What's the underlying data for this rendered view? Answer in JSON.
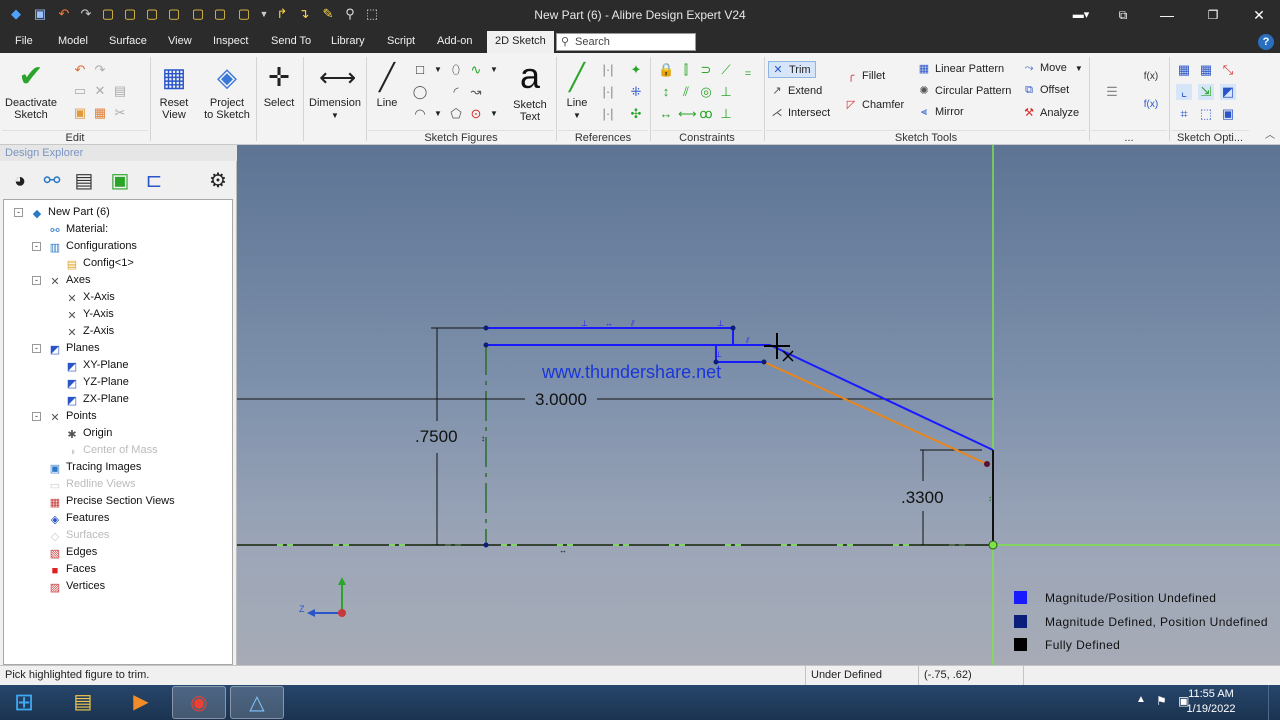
{
  "window": {
    "title": "New Part (6) - Alibre Design Expert V24"
  },
  "menu": {
    "items": [
      "File",
      "Model",
      "Surface",
      "View",
      "Inspect",
      "Send To",
      "Library",
      "Script",
      "Add-on",
      "2D Sketch"
    ],
    "active": "2D Sketch",
    "search_placeholder": "Search"
  },
  "ribbon": {
    "edit": {
      "deactivate_line1": "Deactivate",
      "deactivate_line2": "Sketch",
      "group": "Edit"
    },
    "view": {
      "reset_line1": "Reset",
      "reset_line2": "View",
      "project_line1": "Project",
      "project_line2": "to Sketch"
    },
    "tools": {
      "select": "Select",
      "dimension": "Dimension"
    },
    "figures": {
      "line": "Line",
      "text_line1": "Sketch",
      "text_line2": "Text",
      "group": "Sketch Figures"
    },
    "references": {
      "line": "Line",
      "group": "References"
    },
    "constraints": {
      "group": "Constraints"
    },
    "sketch_tools": {
      "trim": "Trim",
      "extend": "Extend",
      "intersect": "Intersect",
      "fillet": "Fillet",
      "chamfer": "Chamfer",
      "linear_pattern": "Linear Pattern",
      "circular_pattern": "Circular Pattern",
      "mirror": "Mirror",
      "move": "Move",
      "offset": "Offset",
      "analyze": "Analyze",
      "group": "Sketch Tools"
    },
    "more_group": "...",
    "options_group": "Sketch Opti..."
  },
  "explorer": {
    "title": "Design Explorer",
    "tree": [
      {
        "label": "New Part (6)",
        "icon": "part-icon",
        "depth": 0,
        "expand": "-",
        "dim": false
      },
      {
        "label": "Material:",
        "icon": "material-icon",
        "depth": 1,
        "dim": false
      },
      {
        "label": "Configurations",
        "icon": "configurations-icon",
        "depth": 1,
        "expand": "-",
        "dim": false
      },
      {
        "label": "Config<1>",
        "icon": "config-icon",
        "depth": 2,
        "dim": false
      },
      {
        "label": "Axes",
        "icon": "axes-icon",
        "depth": 1,
        "expand": "-",
        "dim": false
      },
      {
        "label": "X-Axis",
        "icon": "axis-icon",
        "depth": 2,
        "dim": false
      },
      {
        "label": "Y-Axis",
        "icon": "axis-icon",
        "depth": 2,
        "dim": false
      },
      {
        "label": "Z-Axis",
        "icon": "axis-icon",
        "depth": 2,
        "dim": false
      },
      {
        "label": "Planes",
        "icon": "planes-icon",
        "depth": 1,
        "expand": "-",
        "dim": false
      },
      {
        "label": "XY-Plane",
        "icon": "plane-icon",
        "depth": 2,
        "dim": false
      },
      {
        "label": "YZ-Plane",
        "icon": "plane-icon",
        "depth": 2,
        "dim": false
      },
      {
        "label": "ZX-Plane",
        "icon": "plane-icon",
        "depth": 2,
        "dim": false
      },
      {
        "label": "Points",
        "icon": "points-icon",
        "depth": 1,
        "expand": "-",
        "dim": false
      },
      {
        "label": "Origin",
        "icon": "origin-icon",
        "depth": 2,
        "dim": false
      },
      {
        "label": "Center of Mass",
        "icon": "center-of-mass-icon",
        "depth": 2,
        "dim": true
      },
      {
        "label": "Tracing Images",
        "icon": "tracing-images-icon",
        "depth": 1,
        "dim": false
      },
      {
        "label": "Redline Views",
        "icon": "redline-views-icon",
        "depth": 1,
        "dim": true
      },
      {
        "label": "Precise Section Views",
        "icon": "section-views-icon",
        "depth": 1,
        "dim": false
      },
      {
        "label": "Features",
        "icon": "features-icon",
        "depth": 1,
        "dim": false
      },
      {
        "label": "Surfaces",
        "icon": "surfaces-icon",
        "depth": 1,
        "dim": true
      },
      {
        "label": "Edges",
        "icon": "edges-icon",
        "depth": 1,
        "dim": false
      },
      {
        "label": "Faces",
        "icon": "faces-icon",
        "depth": 1,
        "dim": false
      },
      {
        "label": "Vertices",
        "icon": "vertices-icon",
        "depth": 1,
        "dim": false
      }
    ]
  },
  "canvas": {
    "watermark": "www.thundershare.net",
    "dimensions": {
      "width": "3.0000",
      "height_left": ".7500",
      "height_right": ".3300"
    },
    "triad_label": "Z",
    "legend": [
      {
        "label": "Magnitude/Position Undefined",
        "color": "#1a1aff"
      },
      {
        "label": "Magnitude Defined, Position Undefined",
        "color": "#0a1e7a"
      },
      {
        "label": "Fully Defined",
        "color": "#000000"
      }
    ],
    "colors": {
      "undefined": "#1a1aff",
      "highlight": "#e8861c",
      "axis": "#7ce34a"
    }
  },
  "status": {
    "hint": "Pick highlighted figure to trim.",
    "state": "Under Defined",
    "coords": "(-.75, .62)"
  },
  "taskbar": {
    "time": "11:55 AM",
    "date": "1/19/2022"
  }
}
